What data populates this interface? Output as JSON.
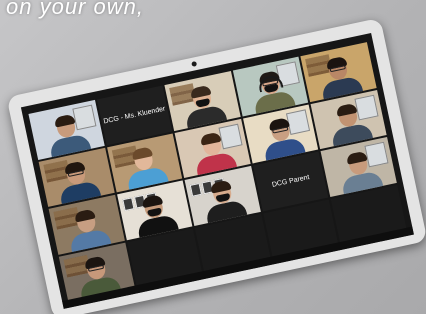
{
  "caption": {
    "text": "on your own,"
  },
  "meeting": {
    "tiles": [
      {
        "type": "video",
        "bg": "#cfd6df",
        "skin": "#c89b7c",
        "hair": "#2a1c12",
        "shirt": "#3c5a7a",
        "mask": false,
        "glasses": false,
        "headset": false,
        "scene": "window"
      },
      {
        "type": "name",
        "label": "DCG - Ms. Kluender"
      },
      {
        "type": "video",
        "bg": "#d8cdb8",
        "skin": "#e0b394",
        "hair": "#3a2a1d",
        "shirt": "#2b2b2b",
        "mask": true,
        "glasses": false,
        "headset": false,
        "scene": "shelf"
      },
      {
        "type": "video",
        "bg": "#b8c8c0",
        "skin": "#d9a88a",
        "hair": "#1f1a16",
        "shirt": "#6b6e4a",
        "mask": true,
        "glasses": true,
        "headset": true,
        "scene": "window"
      },
      {
        "type": "video",
        "bg": "#c9a56a",
        "skin": "#b98766",
        "hair": "#1b1410",
        "shirt": "#2b3a52",
        "mask": false,
        "glasses": true,
        "headset": false,
        "scene": "shelf"
      },
      {
        "type": "video",
        "bg": "#a98c6a",
        "skin": "#c89a7a",
        "hair": "#20160f",
        "shirt": "#1e3d63",
        "mask": false,
        "glasses": true,
        "headset": false,
        "scene": "shelf"
      },
      {
        "type": "video",
        "bg": "#b89a74",
        "skin": "#e2b89a",
        "hair": "#6b4a2b",
        "shirt": "#4c9fd4",
        "mask": false,
        "glasses": false,
        "headset": false,
        "scene": "shelf"
      },
      {
        "type": "video",
        "bg": "#d9c8b4",
        "skin": "#e2b59b",
        "hair": "#3b2414",
        "shirt": "#c0334a",
        "mask": false,
        "glasses": false,
        "headset": false,
        "scene": "window"
      },
      {
        "type": "video",
        "bg": "#e8dcc4",
        "skin": "#c99f82",
        "hair": "#1b1410",
        "shirt": "#2f4f8a",
        "mask": false,
        "glasses": true,
        "headset": false,
        "scene": "window"
      },
      {
        "type": "video",
        "bg": "#cfc3b0",
        "skin": "#c29372",
        "hair": "#2a1c12",
        "shirt": "#3d4b5c",
        "mask": false,
        "glasses": false,
        "headset": false,
        "scene": "window"
      },
      {
        "type": "video",
        "bg": "#8d7a62",
        "skin": "#c79e82",
        "hair": "#2a1c12",
        "shirt": "#547aa6",
        "mask": false,
        "glasses": false,
        "headset": false,
        "scene": "shelf"
      },
      {
        "type": "video",
        "bg": "#e6e0d6",
        "skin": "#c59a7b",
        "hair": "#1b1410",
        "shirt": "#111111",
        "mask": true,
        "glasses": false,
        "headset": false,
        "scene": "frames"
      },
      {
        "type": "video",
        "bg": "#d7d3cc",
        "skin": "#d6ab8d",
        "hair": "#2a1c12",
        "shirt": "#1e1e1e",
        "mask": true,
        "glasses": false,
        "headset": false,
        "scene": "frames"
      },
      {
        "type": "name",
        "label": "DCG Parent"
      },
      {
        "type": "video",
        "bg": "#bfb6a6",
        "skin": "#c89b7c",
        "hair": "#2a1c12",
        "shirt": "#6a7f93",
        "mask": false,
        "glasses": false,
        "headset": false,
        "scene": "window"
      },
      {
        "type": "video",
        "bg": "#7a6e61",
        "skin": "#c7987a",
        "hair": "#1b1410",
        "shirt": "#4a5a3a",
        "mask": false,
        "glasses": true,
        "headset": false,
        "scene": "shelf"
      },
      {
        "type": "video",
        "bg": "#1a1a1a",
        "skin": "#1a1a1a",
        "hair": "#1a1a1a",
        "shirt": "#1a1a1a",
        "mask": false,
        "glasses": false,
        "headset": false,
        "scene": "none"
      },
      {
        "type": "video",
        "bg": "#1a1a1a",
        "skin": "#1a1a1a",
        "hair": "#1a1a1a",
        "shirt": "#1a1a1a",
        "mask": false,
        "glasses": false,
        "headset": false,
        "scene": "none"
      },
      {
        "type": "video",
        "bg": "#1a1a1a",
        "skin": "#1a1a1a",
        "hair": "#1a1a1a",
        "shirt": "#1a1a1a",
        "mask": false,
        "glasses": false,
        "headset": false,
        "scene": "none"
      },
      {
        "type": "video",
        "bg": "#1a1a1a",
        "skin": "#1a1a1a",
        "hair": "#1a1a1a",
        "shirt": "#1a1a1a",
        "mask": false,
        "glasses": false,
        "headset": false,
        "scene": "none"
      }
    ]
  }
}
